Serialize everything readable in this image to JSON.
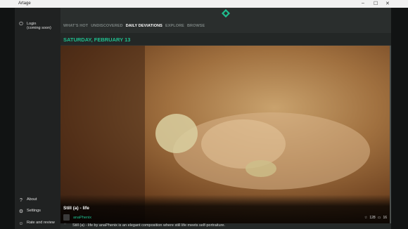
{
  "window": {
    "title": "Artage",
    "controls": [
      "–",
      "☐",
      "✕"
    ]
  },
  "sidebar": {
    "login": {
      "label": "Login",
      "sublabel": "(coming soon)"
    },
    "bottom_items": [
      {
        "label": "About",
        "icon": "question-icon"
      },
      {
        "label": "Settings",
        "icon": "gear-icon"
      },
      {
        "label": "Rate and review",
        "icon": "smiley-icon"
      }
    ]
  },
  "nav": {
    "tabs": [
      "WHAT'S HOT",
      "UNDISCOVERED",
      "DAILY DEVIATIONS",
      "EXPLORE",
      "BROWSE"
    ],
    "active": "DAILY DEVIATIONS"
  },
  "date": "SATURDAY, FEBRUARY 13",
  "deviation": {
    "title": "Still (a) - life",
    "author": "anaPhenix",
    "favorites": "128",
    "comments": "16",
    "description": "Still (a) - life by anaPhenix is an elegant composition where still life meets self-portraiture."
  },
  "colors": {
    "accent": "#1fbf8f",
    "background": "#2c302f",
    "sidebar": "#202222"
  }
}
